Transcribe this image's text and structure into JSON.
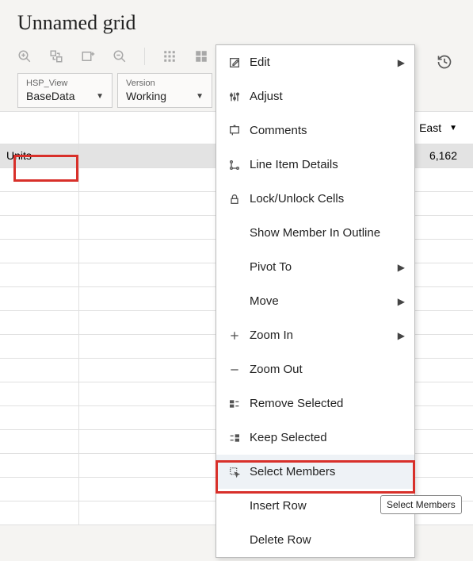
{
  "title": "Unnamed grid",
  "pov": [
    {
      "dim": "HSP_View",
      "value": "BaseData"
    },
    {
      "dim": "Version",
      "value": "Working"
    }
  ],
  "column_header": {
    "label": "East"
  },
  "rows": [
    {
      "label": "Units",
      "value": "6,162",
      "selected": true
    }
  ],
  "context_menu": [
    {
      "id": "edit",
      "label": "Edit",
      "icon": "edit-icon",
      "submenu": true
    },
    {
      "id": "adjust",
      "label": "Adjust",
      "icon": "adjust-icon",
      "submenu": false
    },
    {
      "id": "comments",
      "label": "Comments",
      "icon": "comments-icon",
      "submenu": false
    },
    {
      "id": "lineitem",
      "label": "Line Item Details",
      "icon": "lineitem-icon",
      "submenu": false
    },
    {
      "id": "lock",
      "label": "Lock/Unlock Cells",
      "icon": "lock-icon",
      "submenu": false
    },
    {
      "id": "showmember",
      "label": "Show Member In Outline",
      "icon": "",
      "submenu": false
    },
    {
      "id": "pivot",
      "label": "Pivot To",
      "icon": "",
      "submenu": true
    },
    {
      "id": "move",
      "label": "Move",
      "icon": "",
      "submenu": true
    },
    {
      "id": "zoomin",
      "label": "Zoom In",
      "icon": "plus-icon",
      "submenu": true
    },
    {
      "id": "zoomout",
      "label": "Zoom Out",
      "icon": "minus-icon",
      "submenu": false
    },
    {
      "id": "removeselected",
      "label": "Remove Selected",
      "icon": "remove-sel-icon",
      "submenu": false
    },
    {
      "id": "keepselected",
      "label": "Keep Selected",
      "icon": "keep-sel-icon",
      "submenu": false
    },
    {
      "id": "selectmembers",
      "label": "Select Members",
      "icon": "select-icon",
      "submenu": false,
      "highlighted": true
    },
    {
      "id": "insertrow",
      "label": "Insert Row",
      "icon": "",
      "submenu": false
    },
    {
      "id": "deleterow",
      "label": "Delete Row",
      "icon": "",
      "submenu": false
    }
  ],
  "tooltip": "Select Members"
}
